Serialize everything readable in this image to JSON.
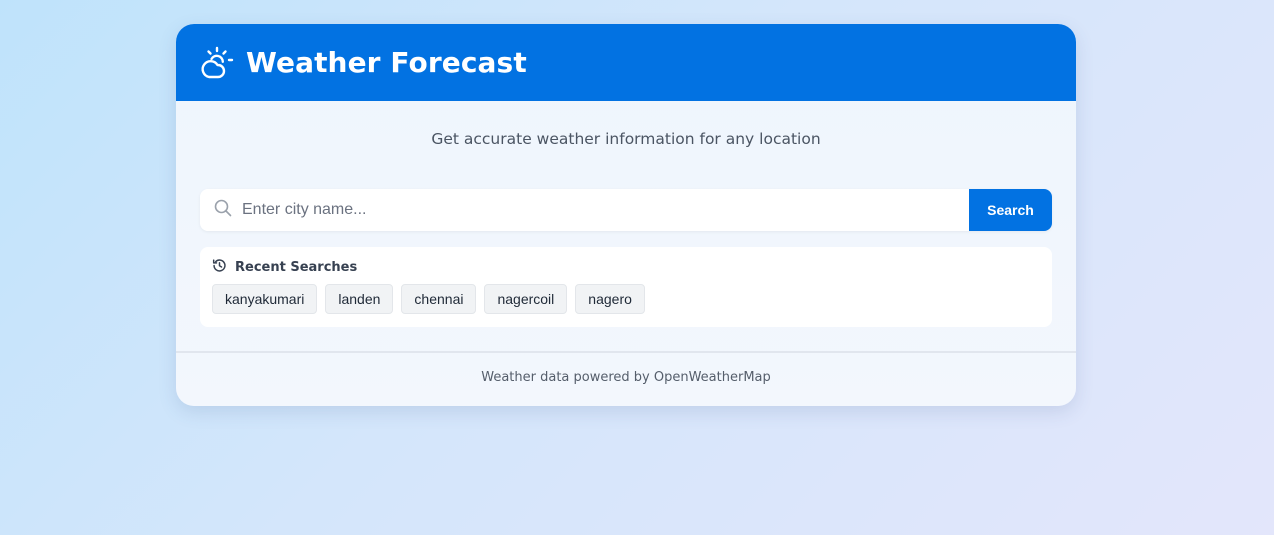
{
  "header": {
    "icon": "partly-cloudy-icon",
    "title": "Weather Forecast"
  },
  "subtitle": "Get accurate weather information for any location",
  "search": {
    "icon": "search-icon",
    "placeholder": "Enter city name...",
    "value": "",
    "button_label": "Search"
  },
  "recent": {
    "icon": "history-icon",
    "heading": "Recent Searches",
    "items": [
      {
        "label": "kanyakumari"
      },
      {
        "label": "landen"
      },
      {
        "label": "chennai"
      },
      {
        "label": "nagercoil"
      },
      {
        "label": "nagero"
      }
    ]
  },
  "footer": {
    "text": "Weather data powered by OpenWeatherMap"
  },
  "colors": {
    "accent": "#0272e2",
    "card_bg": "#f3f7fd",
    "chip_bg": "#f1f3f5"
  }
}
